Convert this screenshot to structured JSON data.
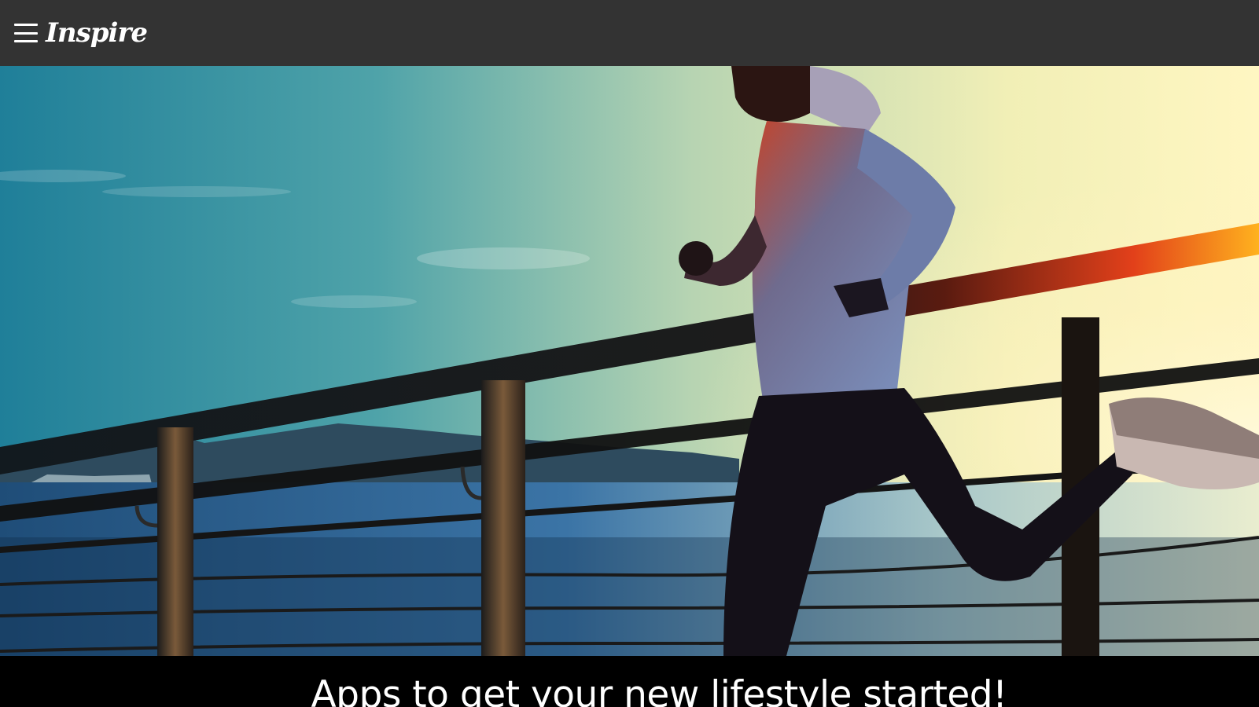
{
  "header": {
    "brand": "Inspire",
    "menu_icon": "hamburger-menu-icon",
    "background": "#333333"
  },
  "hero": {
    "image": "runner-on-boardwalk-at-sunrise",
    "tagline": "Apps to get your new lifestyle started!"
  },
  "colors": {
    "text": "#ffffff",
    "band": "#000000"
  }
}
